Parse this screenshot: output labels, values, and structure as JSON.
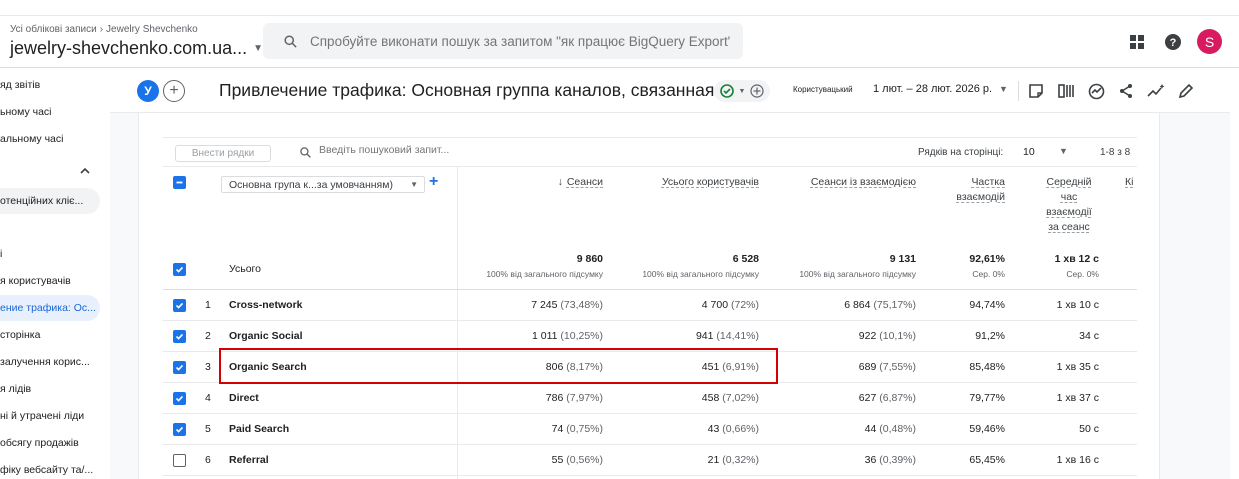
{
  "breadcrumb": {
    "part1": "Усі облікові записи",
    "part2": "Jewelry Shevchenko"
  },
  "account": {
    "name": "jewelry-shevchenko.com.ua..."
  },
  "search": {
    "placeholder": "Спробуйте виконати пошук за запитом \"як працює BigQuery Export\""
  },
  "header_icons": [
    "apps-grid-icon",
    "help-icon"
  ],
  "avatar": {
    "letter": "S",
    "color": "#d81b60"
  },
  "sidenav": {
    "items": [
      {
        "label": "яд звітів"
      },
      {
        "label": "ьному часі"
      },
      {
        "label": "альному часі"
      },
      {
        "label": "отенційних кліє..."
      },
      {
        "label": "і"
      },
      {
        "label": "я користувачів"
      },
      {
        "label": "ение трафика: Ос..."
      },
      {
        "label": "сторінка"
      },
      {
        "label": "залучення корис..."
      },
      {
        "label": "я лідів"
      },
      {
        "label": "ні й утрачені ліди"
      },
      {
        "label": "обсягу продажів"
      },
      {
        "label": "фіку вебсайту та/..."
      }
    ]
  },
  "toolbar": {
    "segment_letter": "У",
    "title": "Привлечение трафика: Основная группа каналов, связанная с ...",
    "compare_label": "Користувацький",
    "date_range": "1 лют. – 28 лют. 2026 р."
  },
  "table_toolbar": {
    "plot_rows": "Внести рядки",
    "search_placeholder": "Введіть пошуковий запит...",
    "rows_per_page_label": "Рядків на сторінці:",
    "rows_per_page": "10",
    "pager": "1-8 з 8"
  },
  "table": {
    "dimension": "Основна група к...за умовчанням)",
    "headers": {
      "sessions": "Сеанси",
      "users": "Усього користувачів",
      "engaged": "Сеанси із взаємодією",
      "eng_rate_1": "Частка",
      "eng_rate_2": "взаємодій",
      "avg_1": "Середній",
      "avg_2": "час",
      "avg_3": "взаємодії",
      "avg_4": "за сеанс",
      "next": "Кі"
    },
    "total": {
      "label": "Усього",
      "sessions": "9 860",
      "users": "6 528",
      "engaged": "9 131",
      "eng_rate": "92,61%",
      "avg": "1 хв 12 с",
      "sessions_sub": "100% від загального підсумку",
      "users_sub": "100% від загального підсумку",
      "engaged_sub": "100% від загального підсумку",
      "eng_rate_sub": "Сер. 0%",
      "avg_sub": "Сер. 0%"
    },
    "rows": [
      {
        "idx": "1",
        "dim": "Cross-network",
        "sessions": "7 245",
        "sessions_p": "(73,48%)",
        "users": "4 700",
        "users_p": "(72%)",
        "engaged": "6 864",
        "engaged_p": "(75,17%)",
        "eng_rate": "94,74%",
        "avg": "1 хв 10 с",
        "checked": true
      },
      {
        "idx": "2",
        "dim": "Organic Social",
        "sessions": "1 011",
        "sessions_p": "(10,25%)",
        "users": "941",
        "users_p": "(14,41%)",
        "engaged": "922",
        "engaged_p": "(10,1%)",
        "eng_rate": "91,2%",
        "avg": "34 с",
        "checked": true
      },
      {
        "idx": "3",
        "dim": "Organic Search",
        "sessions": "806",
        "sessions_p": "(8,17%)",
        "users": "451",
        "users_p": "(6,91%)",
        "engaged": "689",
        "engaged_p": "(7,55%)",
        "eng_rate": "85,48%",
        "avg": "1 хв 35 с",
        "checked": true
      },
      {
        "idx": "4",
        "dim": "Direct",
        "sessions": "786",
        "sessions_p": "(7,97%)",
        "users": "458",
        "users_p": "(7,02%)",
        "engaged": "627",
        "engaged_p": "(6,87%)",
        "eng_rate": "79,77%",
        "avg": "1 хв 37 с",
        "checked": true
      },
      {
        "idx": "5",
        "dim": "Paid Search",
        "sessions": "74",
        "sessions_p": "(0,75%)",
        "users": "43",
        "users_p": "(0,66%)",
        "engaged": "44",
        "engaged_p": "(0,48%)",
        "eng_rate": "59,46%",
        "avg": "50 с",
        "checked": true
      },
      {
        "idx": "6",
        "dim": "Referral",
        "sessions": "55",
        "sessions_p": "(0,56%)",
        "users": "21",
        "users_p": "(0,32%)",
        "engaged": "36",
        "engaged_p": "(0,39%)",
        "eng_rate": "65,45%",
        "avg": "1 хв 16 с",
        "checked": false
      }
    ]
  },
  "colors": {
    "accent": "#1a73e8",
    "highlight": "#d50000"
  }
}
